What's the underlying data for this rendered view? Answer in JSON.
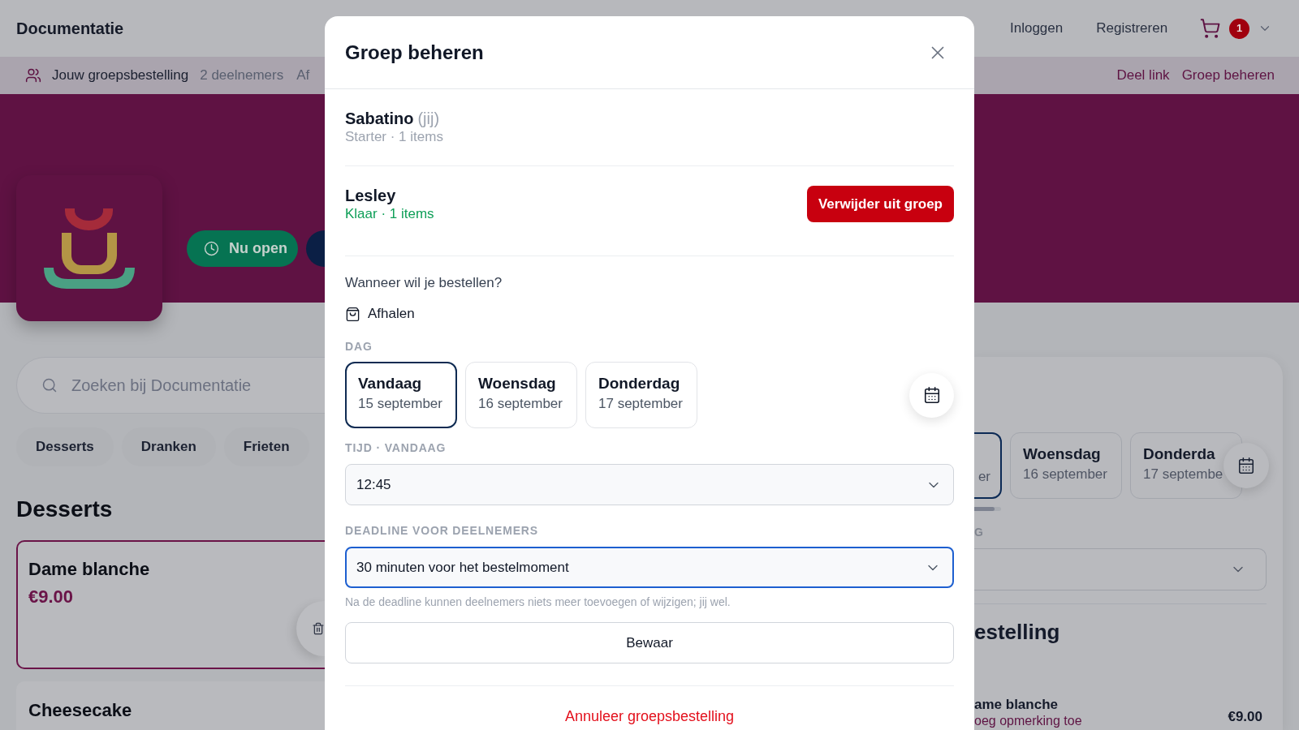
{
  "header": {
    "brand": "Documentatie",
    "links": [
      "Inloggen",
      "Registreren"
    ],
    "cart_count": "1"
  },
  "group_bar": {
    "title": "Jouw groepsbestelling",
    "participants": "2 deelnemers",
    "method": "Af",
    "actions": [
      "Deel link",
      "Groep beheren"
    ]
  },
  "restaurant": {
    "status": "Nu open"
  },
  "search": {
    "placeholder": "Zoeken bij Documentatie"
  },
  "categories": [
    "Desserts",
    "Dranken",
    "Frieten"
  ],
  "menu": {
    "title": "Desserts",
    "items": [
      {
        "name": "Dame blanche",
        "price": "€9.00",
        "in_cart": true
      },
      {
        "name": "Cheesecake",
        "in_cart": false
      }
    ]
  },
  "order_panel": {
    "days": [
      {
        "date": "er",
        "selected": true
      },
      {
        "day": "Woensdag",
        "date": "16 september",
        "selected": false
      },
      {
        "day": "Donderda",
        "date": "17 septembe",
        "selected": false
      }
    ],
    "label": "G",
    "heading": "estelling",
    "lines": [
      {
        "name": "ame blanche",
        "note": "oeg opmerking toe",
        "price": "€9.00"
      }
    ]
  },
  "dialog": {
    "title": "Groep beheren",
    "members": [
      {
        "name": "Sabatino",
        "note": "(jij)",
        "status": "Starter · 1 items",
        "ready": false
      },
      {
        "name": "Lesley",
        "status": "Klaar · 1 items",
        "ready": true,
        "action": "Verwijder uit groep"
      }
    ],
    "question": "Wanneer wil je bestellen?",
    "method": "Afhalen",
    "day_label": "DAG",
    "days": [
      {
        "day": "Vandaag",
        "date": "15 september",
        "selected": true
      },
      {
        "day": "Woensdag",
        "date": "16 september",
        "selected": false
      },
      {
        "day": "Donderdag",
        "date": "17 september",
        "selected": false
      }
    ],
    "time": {
      "label": "TIJD · VANDAAG",
      "value": "12:45",
      "focused": false
    },
    "deadline": {
      "label": "DEADLINE VOOR DEELNEMERS",
      "value": "30 minuten voor het bestelmoment",
      "focused": true
    },
    "hint": "Na de deadline kunnen deelnemers niets meer toevoegen of wijzigen; jij wel.",
    "save": "Bewaar",
    "cancel": "Annuleer groepsbestelling"
  }
}
